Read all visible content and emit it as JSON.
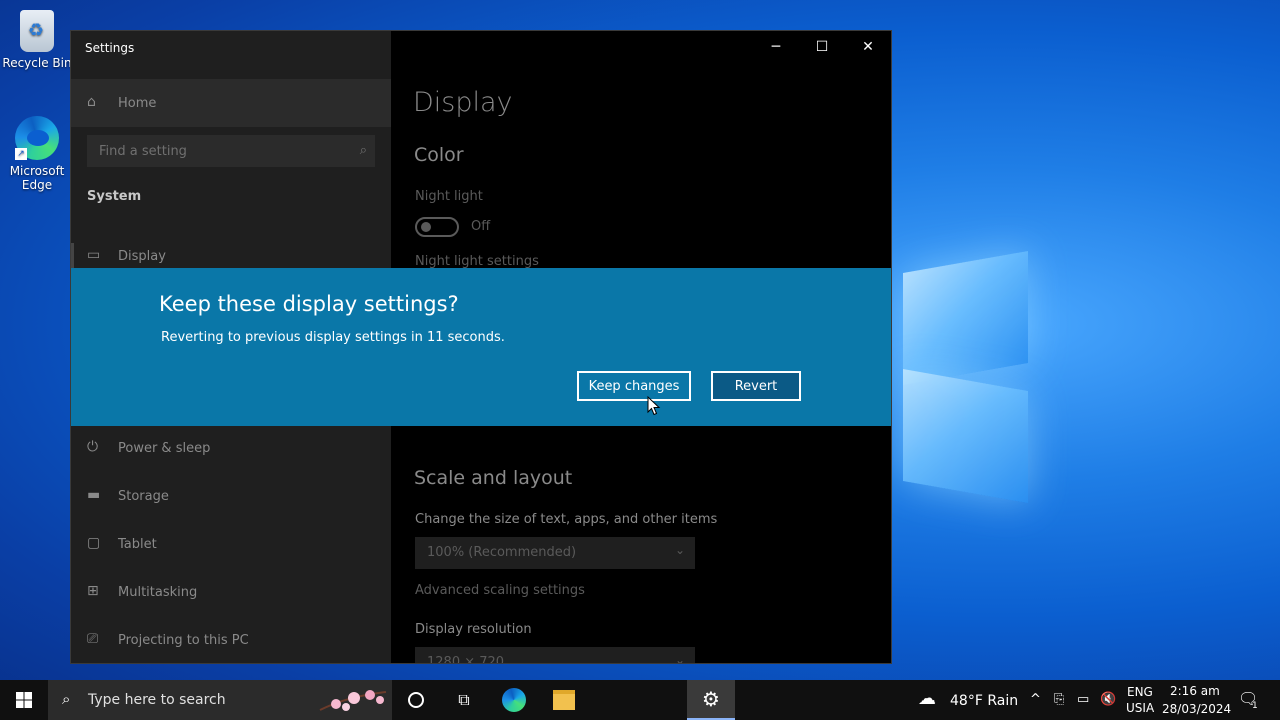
{
  "desktop": {
    "icons": [
      {
        "label": "Recycle Bin"
      },
      {
        "label": "Microsoft Edge"
      }
    ]
  },
  "window": {
    "title": "Settings",
    "controls": {
      "minimize": "─",
      "maximize": "☐",
      "close": "✕"
    }
  },
  "sidebar": {
    "home": "Home",
    "search_placeholder": "Find a setting",
    "section": "System",
    "items": [
      {
        "label": "Display"
      },
      {
        "label": "Power & sleep"
      },
      {
        "label": "Storage"
      },
      {
        "label": "Tablet"
      },
      {
        "label": "Multitasking"
      },
      {
        "label": "Projecting to this PC"
      }
    ]
  },
  "content": {
    "title": "Display",
    "color_heading": "Color",
    "night_light_label": "Night light",
    "night_light_state": "Off",
    "night_light_settings": "Night light settings",
    "scale_heading": "Scale and layout",
    "scale_label": "Change the size of text, apps, and other items",
    "scale_value": "100% (Recommended)",
    "advanced_scaling": "Advanced scaling settings",
    "resolution_label": "Display resolution",
    "resolution_value": "1280 × 720"
  },
  "dialog": {
    "title": "Keep these display settings?",
    "message": "Reverting to previous display settings in 11 seconds.",
    "keep_label": "Keep changes",
    "revert_label": "Revert"
  },
  "taskbar": {
    "search_placeholder": "Type here to search",
    "weather": "48°F  Rain",
    "language_top": "ENG",
    "language_bottom": "USIA",
    "time": "2:16 am",
    "date": "28/03/2024",
    "notification_count": "1"
  },
  "colors": {
    "dialog_bg": "#0a77a8",
    "taskbar_bg": "#101010",
    "desktop_accent": "#0b5fd0"
  }
}
